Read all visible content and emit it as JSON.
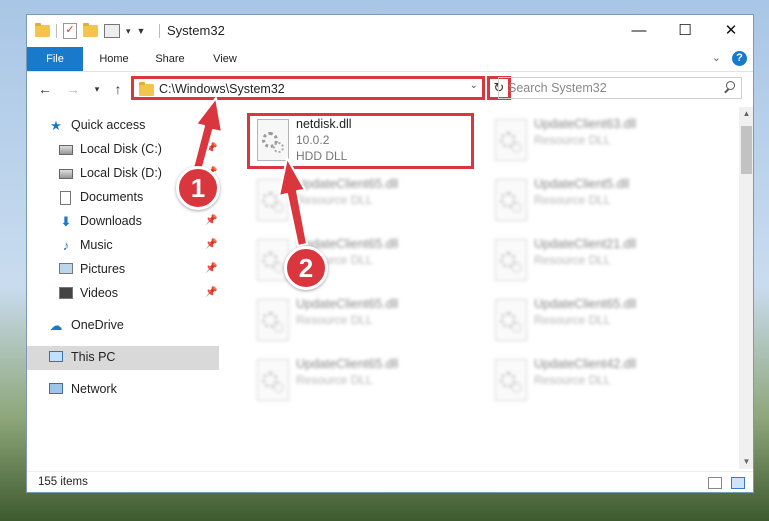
{
  "window": {
    "title": "System32",
    "controls": {
      "minimize": "—",
      "maximize": "☐",
      "close": "✕"
    }
  },
  "ribbon": {
    "tabs": [
      "File",
      "Home",
      "Share",
      "View"
    ],
    "help": "?"
  },
  "address": {
    "path": "C:\\Windows\\System32",
    "search_placeholder": "Search System32"
  },
  "nav_pane": {
    "items": [
      {
        "label": "Quick access",
        "icon": "star-icon",
        "pinned": false,
        "selected": false
      },
      {
        "label": "Local Disk (C:)",
        "icon": "drive-icon",
        "pinned": true,
        "selected": false
      },
      {
        "label": "Local Disk (D:)",
        "icon": "drive-icon",
        "pinned": true,
        "selected": false
      },
      {
        "label": "Documents",
        "icon": "documents-icon",
        "pinned": true,
        "selected": false
      },
      {
        "label": "Downloads",
        "icon": "downloads-icon",
        "pinned": true,
        "selected": false
      },
      {
        "label": "Music",
        "icon": "music-icon",
        "pinned": true,
        "selected": false
      },
      {
        "label": "Pictures",
        "icon": "pictures-icon",
        "pinned": true,
        "selected": false
      },
      {
        "label": "Videos",
        "icon": "videos-icon",
        "pinned": true,
        "selected": false
      },
      {
        "label": "OneDrive",
        "icon": "cloud-icon",
        "pinned": false,
        "selected": false
      },
      {
        "label": "This PC",
        "icon": "computer-icon",
        "pinned": false,
        "selected": true
      },
      {
        "label": "Network",
        "icon": "network-icon",
        "pinned": false,
        "selected": false
      }
    ]
  },
  "files": [
    {
      "name": "netdisk.dll",
      "line2": "10.0.2",
      "line3": "HDD DLL",
      "highlighted": true
    },
    {
      "name": "UpdateClient63.dll",
      "line2": "Resource DLL",
      "highlighted": false
    },
    {
      "name": "UpdateClient65.dll",
      "line2": "Resource DLL",
      "highlighted": false
    },
    {
      "name": "UpdateClient5.dll",
      "line2": "Resource DLL",
      "highlighted": false
    },
    {
      "name": "UpdateClient65.dll",
      "line2": "Resource DLL",
      "highlighted": false
    },
    {
      "name": "UpdateClient21.dll",
      "line2": "Resource DLL",
      "highlighted": false
    },
    {
      "name": "UpdateClient65.dll",
      "line2": "Resource DLL",
      "highlighted": false
    },
    {
      "name": "UpdateClient65.dll",
      "line2": "Resource DLL",
      "highlighted": false
    },
    {
      "name": "UpdateClient65.dll",
      "line2": "Resource DLL",
      "highlighted": false
    },
    {
      "name": "UpdateClient42.dll",
      "line2": "Resource DLL",
      "highlighted": false
    }
  ],
  "status": {
    "item_count": "155 items"
  },
  "callouts": [
    "1",
    "2"
  ],
  "colors": {
    "accent": "#1979ca",
    "highlight": "#d9363e"
  }
}
